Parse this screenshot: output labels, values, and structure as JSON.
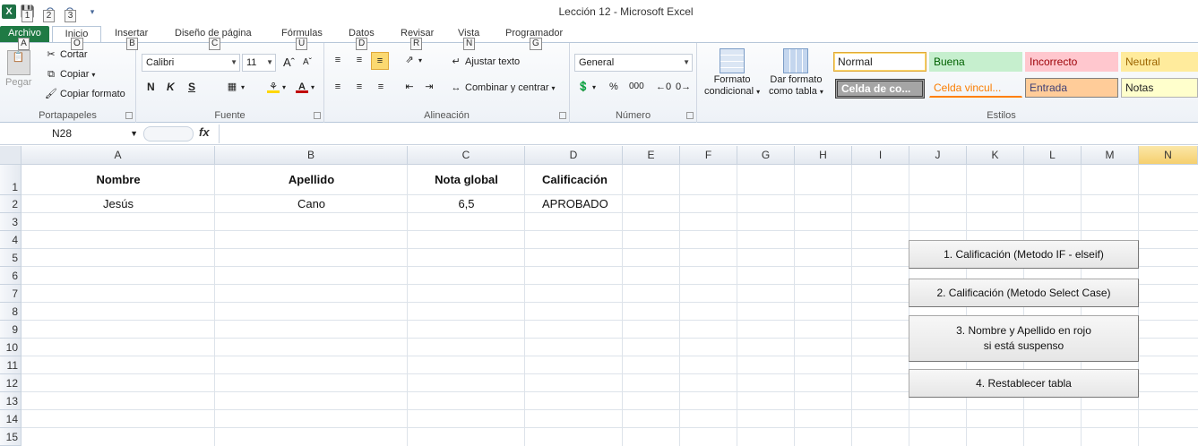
{
  "window": {
    "title": "Lección 12  -  Microsoft Excel",
    "qat_keytips": [
      "1",
      "2",
      "3"
    ]
  },
  "tabs": [
    {
      "label": "Archivo",
      "keytip": "A"
    },
    {
      "label": "Inicio",
      "keytip": "O"
    },
    {
      "label": "Insertar",
      "keytip": "B"
    },
    {
      "label": "Diseño de página",
      "keytip": "C"
    },
    {
      "label": "Fórmulas",
      "keytip": "U"
    },
    {
      "label": "Datos",
      "keytip": "D"
    },
    {
      "label": "Revisar",
      "keytip": "R"
    },
    {
      "label": "Vista",
      "keytip": "N"
    },
    {
      "label": "Programador",
      "keytip": "G"
    }
  ],
  "ribbon": {
    "clipboard": {
      "paste": "Pegar",
      "cut": "Cortar",
      "copy": "Copiar",
      "format_painter": "Copiar formato",
      "label": "Portapapeles"
    },
    "font": {
      "name": "Calibri",
      "size": "11",
      "bold": "N",
      "italic": "K",
      "underline": "S",
      "label": "Fuente"
    },
    "alignment": {
      "wrap": "Ajustar texto",
      "merge": "Combinar y centrar",
      "label": "Alineación"
    },
    "number": {
      "format": "General",
      "percent": "%",
      "thousands": "000",
      "label": "Número"
    },
    "styles": {
      "conditional": "Formato condicional",
      "conditional_1": "Formato",
      "conditional_2": "condicional",
      "table_1": "Dar formato",
      "table_2": "como tabla",
      "label": "Estilos",
      "cells": [
        {
          "label": "Normal"
        },
        {
          "label": "Buena"
        },
        {
          "label": "Incorrecto"
        },
        {
          "label": "Neutral"
        },
        {
          "label": "Celda de co..."
        },
        {
          "label": "Celda vincul..."
        },
        {
          "label": "Entrada"
        },
        {
          "label": "Notas"
        }
      ]
    }
  },
  "formula_bar": {
    "name_box": "N28",
    "fx": "fx",
    "formula": ""
  },
  "columns": [
    "A",
    "B",
    "C",
    "D",
    "E",
    "F",
    "G",
    "H",
    "I",
    "J",
    "K",
    "L",
    "M",
    "N"
  ],
  "rows": [
    "1",
    "2",
    "3",
    "4",
    "5",
    "6",
    "7",
    "8",
    "9",
    "10",
    "11",
    "12",
    "13",
    "14",
    "15"
  ],
  "cells": {
    "A1": "Nombre",
    "B1": "Apellido",
    "C1": "Nota global",
    "D1": "Calificación",
    "A2": "Jesús",
    "B2": "Cano",
    "C2": "6,5",
    "D2": "APROBADO"
  },
  "macro_buttons": [
    "1. Calificación (Metodo IF - elseif)",
    "2. Calificación (Metodo Select Case)",
    "3. Nombre y Apellido en rojo\nsi está suspenso",
    "4. Restablecer tabla"
  ],
  "colors": {
    "file_tab": "#1f7a44",
    "selected_col": "#f5cf6e",
    "font_color": "#c00000",
    "fill_color": "#ffd700"
  }
}
